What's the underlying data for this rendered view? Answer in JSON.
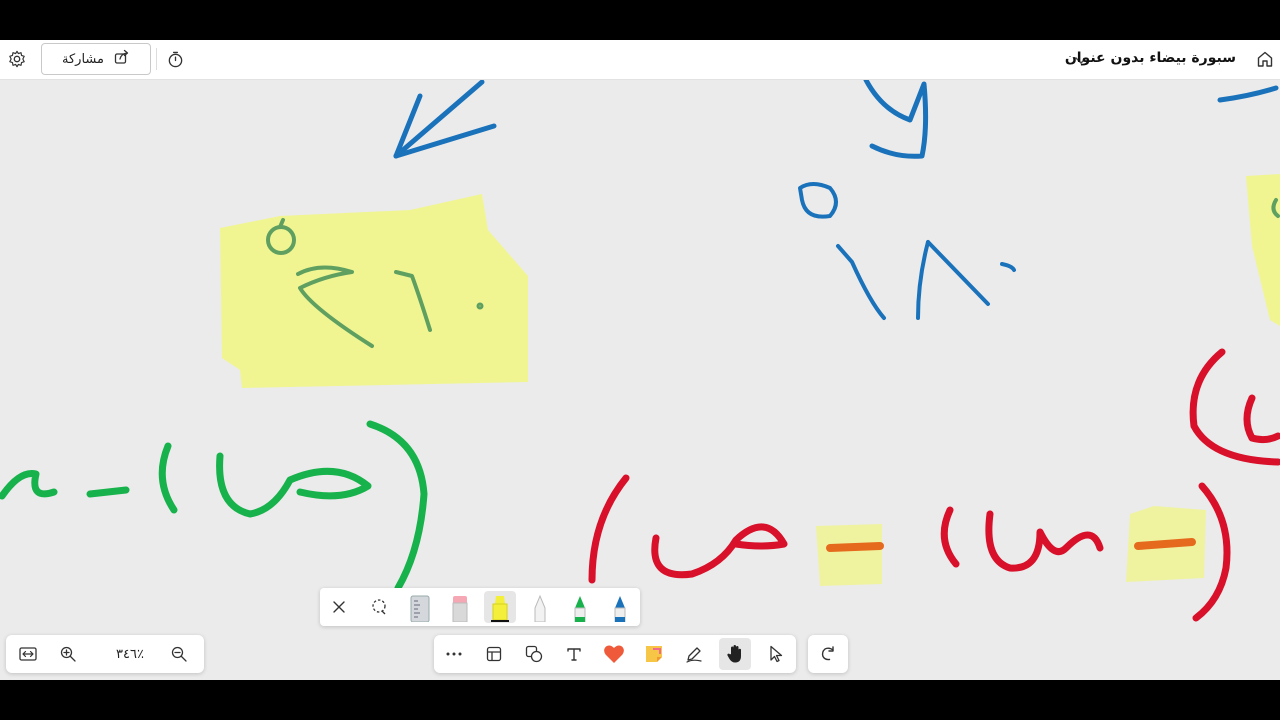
{
  "header": {
    "title": "سبورة بيضاء بدون عنوان",
    "share_label": "مشاركة"
  },
  "canvas": {
    "sticky_notes": [
      {
        "text": "٢٧٠",
        "degree_mark": "°",
        "note_color": "#f0f592",
        "ink_color": "#5fa061"
      },
      {
        "text": "١٨٠",
        "degree_mark": "°",
        "ink_color": "#1a72bb"
      }
    ],
    "ink_colors": {
      "blue": "#1a72bb",
      "green": "#17b24b",
      "red": "#d8102a",
      "orange": "#e56a1d",
      "highlight": "#f0f592"
    }
  },
  "bottom_left": {
    "zoom_level": "٪٣٤٦"
  },
  "pen_tray": {
    "items": [
      "close-icon",
      "lasso-icon",
      "ruler-icon",
      "eraser-icon",
      "yellow-highlighter-icon",
      "white-pen-icon",
      "green-pen-icon",
      "blue-pen-icon"
    ]
  },
  "toolbar": {
    "items": [
      "more-icon",
      "templates-icon",
      "shapes-icon",
      "text-icon",
      "reactions-icon",
      "sticky-note-icon",
      "inking-icon",
      "hand-icon",
      "select-icon"
    ],
    "active": "hand-icon"
  }
}
